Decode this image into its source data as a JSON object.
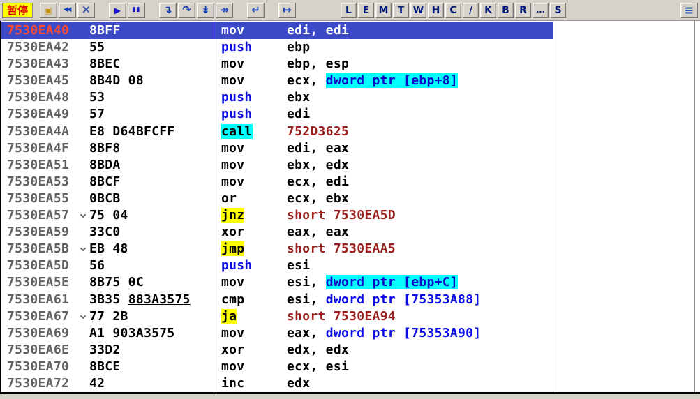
{
  "toolbar": {
    "status_label": "暂停",
    "windows_button": {
      "glyph": "≡"
    },
    "groups": [
      {
        "name": "toolbar-group-file",
        "buttons": [
          {
            "name": "open-button",
            "icon": "folder-open-icon",
            "glyph": "▣",
            "cls": "ic-folder",
            "color": "#C09010"
          },
          {
            "name": "restart-button",
            "icon": "restart-icon",
            "glyph": "◀◀",
            "cls": "ic-restart"
          },
          {
            "name": "close-button",
            "icon": "close-icon",
            "glyph": "×",
            "cls": "ic-close",
            "color": "#3858A8"
          }
        ]
      },
      {
        "name": "toolbar-group-run",
        "buttons": [
          {
            "name": "run-button",
            "icon": "play-icon",
            "glyph": "▶",
            "cls": "ic-play",
            "color": "#1818C8"
          },
          {
            "name": "pause-button",
            "icon": "pause-icon",
            "glyph": "▮▮",
            "cls": "ic-pause",
            "color": "#1818C8"
          }
        ]
      },
      {
        "name": "toolbar-group-step",
        "buttons": [
          {
            "name": "step-into-button",
            "icon": "step-into-icon",
            "glyph": "↴",
            "cls": "ic-arrow"
          },
          {
            "name": "step-over-button",
            "icon": "step-over-icon",
            "glyph": "↷",
            "cls": "ic-arrow"
          },
          {
            "name": "trace-into-button",
            "icon": "trace-into-icon",
            "glyph": "↡",
            "cls": "ic-arrow"
          },
          {
            "name": "trace-over-button",
            "icon": "trace-over-icon",
            "glyph": "↠",
            "cls": "ic-arrow"
          }
        ]
      },
      {
        "name": "toolbar-group-return",
        "buttons": [
          {
            "name": "execute-till-return-button",
            "icon": "return-icon",
            "glyph": "↵",
            "cls": "ic-arrow"
          }
        ]
      },
      {
        "name": "toolbar-group-goto",
        "buttons": [
          {
            "name": "go-to-button",
            "icon": "goto-icon",
            "glyph": "↦",
            "cls": "ic-arrow"
          }
        ]
      },
      {
        "name": "toolbar-group-views",
        "cls": "letters",
        "buttons": [
          {
            "name": "view-log-button",
            "label": "L"
          },
          {
            "name": "view-executables-button",
            "label": "E"
          },
          {
            "name": "view-memory-button",
            "label": "M"
          },
          {
            "name": "view-threads-button",
            "label": "T"
          },
          {
            "name": "view-windows-button",
            "label": "W"
          },
          {
            "name": "view-handles-button",
            "label": "H"
          },
          {
            "name": "view-cpu-button",
            "label": "C"
          },
          {
            "name": "view-patches-button",
            "label": "/"
          },
          {
            "name": "view-callstack-button",
            "label": "K"
          },
          {
            "name": "view-breakpoints-button",
            "label": "B"
          },
          {
            "name": "view-references-button",
            "label": "R"
          },
          {
            "name": "view-runtrace-button",
            "label": "...",
            "cls": "ic-dots"
          },
          {
            "name": "view-source-button",
            "label": "S"
          }
        ]
      }
    ]
  },
  "colors": {
    "selection_bg": "#3C4AC8",
    "selected_address": "#FF4A2E",
    "memory_highlight_bg": "#00FFFF",
    "jump_highlight_bg": "#FFFF00",
    "push_mnemonic": "#0A0AE6",
    "jump_target": "#9A2020",
    "status_label_bg": "#FFFF00",
    "status_label_text": "#E00000"
  },
  "disassembly": {
    "rows": [
      {
        "address": "7530EA40",
        "selected": true,
        "jump_arrow": false,
        "bytes": [
          {
            "t": "8BFF",
            "s": "p"
          }
        ],
        "mn": {
          "t": "mov",
          "s": "plain"
        },
        "ops": [
          {
            "t": "edi, edi",
            "s": "plain"
          }
        ]
      },
      {
        "address": "7530EA42",
        "selected": false,
        "jump_arrow": false,
        "bytes": [
          {
            "t": "55",
            "s": "p"
          }
        ],
        "mn": {
          "t": "push",
          "s": "push"
        },
        "ops": [
          {
            "t": "ebp",
            "s": "plain"
          }
        ]
      },
      {
        "address": "7530EA43",
        "selected": false,
        "jump_arrow": false,
        "bytes": [
          {
            "t": "8BEC",
            "s": "p"
          }
        ],
        "mn": {
          "t": "mov",
          "s": "plain"
        },
        "ops": [
          {
            "t": "ebp, esp",
            "s": "plain"
          }
        ]
      },
      {
        "address": "7530EA45",
        "selected": false,
        "jump_arrow": false,
        "bytes": [
          {
            "t": "8B4D 08",
            "s": "p"
          }
        ],
        "mn": {
          "t": "mov",
          "s": "plain"
        },
        "ops": [
          {
            "t": "ecx, ",
            "s": "plain"
          },
          {
            "t": "dword ptr [ebp+8]",
            "s": "memhl"
          }
        ]
      },
      {
        "address": "7530EA48",
        "selected": false,
        "jump_arrow": false,
        "bytes": [
          {
            "t": "53",
            "s": "p"
          }
        ],
        "mn": {
          "t": "push",
          "s": "push"
        },
        "ops": [
          {
            "t": "ebx",
            "s": "plain"
          }
        ]
      },
      {
        "address": "7530EA49",
        "selected": false,
        "jump_arrow": false,
        "bytes": [
          {
            "t": "57",
            "s": "p"
          }
        ],
        "mn": {
          "t": "push",
          "s": "push"
        },
        "ops": [
          {
            "t": "edi",
            "s": "plain"
          }
        ]
      },
      {
        "address": "7530EA4A",
        "selected": false,
        "jump_arrow": false,
        "bytes": [
          {
            "t": "E8 D64BFCFF",
            "s": "p"
          }
        ],
        "mn": {
          "t": "call",
          "s": "call"
        },
        "ops": [
          {
            "t": "752D3625",
            "s": "target"
          }
        ]
      },
      {
        "address": "7530EA4F",
        "selected": false,
        "jump_arrow": false,
        "bytes": [
          {
            "t": "8BF8",
            "s": "p"
          }
        ],
        "mn": {
          "t": "mov",
          "s": "plain"
        },
        "ops": [
          {
            "t": "edi, eax",
            "s": "plain"
          }
        ]
      },
      {
        "address": "7530EA51",
        "selected": false,
        "jump_arrow": false,
        "bytes": [
          {
            "t": "8BDA",
            "s": "p"
          }
        ],
        "mn": {
          "t": "mov",
          "s": "plain"
        },
        "ops": [
          {
            "t": "ebx, edx",
            "s": "plain"
          }
        ]
      },
      {
        "address": "7530EA53",
        "selected": false,
        "jump_arrow": false,
        "bytes": [
          {
            "t": "8BCF",
            "s": "p"
          }
        ],
        "mn": {
          "t": "mov",
          "s": "plain"
        },
        "ops": [
          {
            "t": "ecx, edi",
            "s": "plain"
          }
        ]
      },
      {
        "address": "7530EA55",
        "selected": false,
        "jump_arrow": false,
        "bytes": [
          {
            "t": "0BCB",
            "s": "p"
          }
        ],
        "mn": {
          "t": "or",
          "s": "plain"
        },
        "ops": [
          {
            "t": "ecx, ebx",
            "s": "plain"
          }
        ]
      },
      {
        "address": "7530EA57",
        "selected": false,
        "jump_arrow": true,
        "bytes": [
          {
            "t": "75 04",
            "s": "p"
          }
        ],
        "mn": {
          "t": "jnz",
          "s": "jump"
        },
        "ops": [
          {
            "t": "short 7530EA5D",
            "s": "target"
          }
        ]
      },
      {
        "address": "7530EA59",
        "selected": false,
        "jump_arrow": false,
        "bytes": [
          {
            "t": "33C0",
            "s": "p"
          }
        ],
        "mn": {
          "t": "xor",
          "s": "plain"
        },
        "ops": [
          {
            "t": "eax, eax",
            "s": "plain"
          }
        ]
      },
      {
        "address": "7530EA5B",
        "selected": false,
        "jump_arrow": true,
        "bytes": [
          {
            "t": "EB 48",
            "s": "p"
          }
        ],
        "mn": {
          "t": "jmp",
          "s": "jump"
        },
        "ops": [
          {
            "t": "short 7530EAA5",
            "s": "target"
          }
        ]
      },
      {
        "address": "7530EA5D",
        "selected": false,
        "jump_arrow": false,
        "bytes": [
          {
            "t": "56",
            "s": "p"
          }
        ],
        "mn": {
          "t": "push",
          "s": "push"
        },
        "ops": [
          {
            "t": "esi",
            "s": "plain"
          }
        ]
      },
      {
        "address": "7530EA5E",
        "selected": false,
        "jump_arrow": false,
        "bytes": [
          {
            "t": "8B75 0C",
            "s": "p"
          }
        ],
        "mn": {
          "t": "mov",
          "s": "plain"
        },
        "ops": [
          {
            "t": "esi, ",
            "s": "plain"
          },
          {
            "t": "dword ptr [ebp+C]",
            "s": "memhl"
          }
        ]
      },
      {
        "address": "7530EA61",
        "selected": false,
        "jump_arrow": false,
        "bytes": [
          {
            "t": "3B35 ",
            "s": "p"
          },
          {
            "t": "883A3575",
            "s": "u"
          }
        ],
        "mn": {
          "t": "cmp",
          "s": "plain"
        },
        "ops": [
          {
            "t": "esi, ",
            "s": "plain"
          },
          {
            "t": "dword ptr [75353A88]",
            "s": "mem"
          }
        ]
      },
      {
        "address": "7530EA67",
        "selected": false,
        "jump_arrow": true,
        "bytes": [
          {
            "t": "77 2B",
            "s": "p"
          }
        ],
        "mn": {
          "t": "ja",
          "s": "jump"
        },
        "ops": [
          {
            "t": "short 7530EA94",
            "s": "target"
          }
        ]
      },
      {
        "address": "7530EA69",
        "selected": false,
        "jump_arrow": false,
        "bytes": [
          {
            "t": "A1 ",
            "s": "p"
          },
          {
            "t": "903A3575",
            "s": "u"
          }
        ],
        "mn": {
          "t": "mov",
          "s": "plain"
        },
        "ops": [
          {
            "t": "eax, ",
            "s": "plain"
          },
          {
            "t": "dword ptr [75353A90]",
            "s": "mem"
          }
        ]
      },
      {
        "address": "7530EA6E",
        "selected": false,
        "jump_arrow": false,
        "bytes": [
          {
            "t": "33D2",
            "s": "p"
          }
        ],
        "mn": {
          "t": "xor",
          "s": "plain"
        },
        "ops": [
          {
            "t": "edx, edx",
            "s": "plain"
          }
        ]
      },
      {
        "address": "7530EA70",
        "selected": false,
        "jump_arrow": false,
        "bytes": [
          {
            "t": "8BCE",
            "s": "p"
          }
        ],
        "mn": {
          "t": "mov",
          "s": "plain"
        },
        "ops": [
          {
            "t": "ecx, esi",
            "s": "plain"
          }
        ]
      },
      {
        "address": "7530EA72",
        "selected": false,
        "jump_arrow": false,
        "bytes": [
          {
            "t": "42",
            "s": "p"
          }
        ],
        "mn": {
          "t": "inc",
          "s": "plain"
        },
        "ops": [
          {
            "t": "edx",
            "s": "plain"
          }
        ]
      }
    ]
  }
}
